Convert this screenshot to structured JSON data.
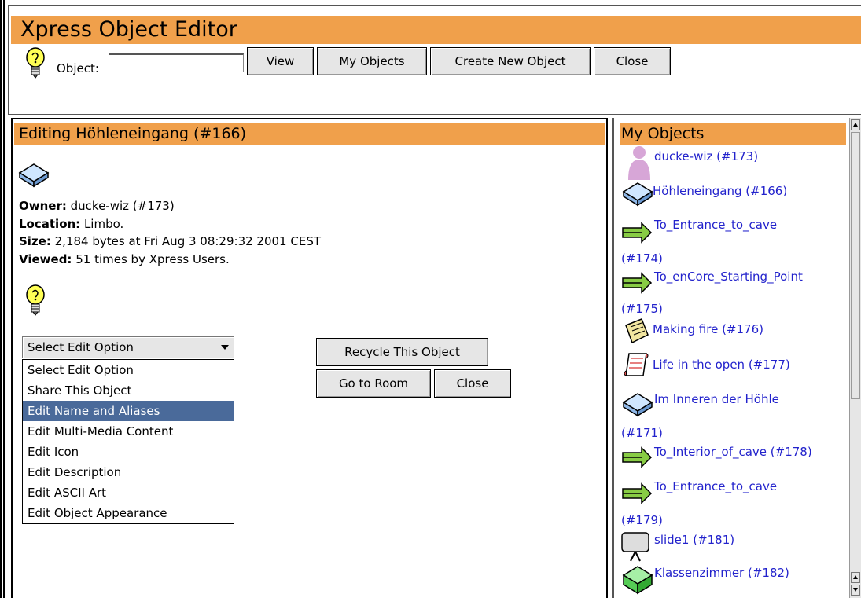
{
  "header": {
    "title": "Xpress Object Editor",
    "object_label": "Object:",
    "object_value": "",
    "buttons": {
      "view": "View",
      "my_objects": "My Objects",
      "create_new": "Create New Object",
      "close": "Close"
    }
  },
  "editor": {
    "heading": "Editing Höhleneingang (#166)",
    "owner_label": "Owner:",
    "owner_value": "ducke-wiz (#173)",
    "location_label": "Location:",
    "location_value": "Limbo.",
    "size_label": "Size:",
    "size_value": "2,184 bytes at Fri Aug 3 08:29:32 2001 CEST",
    "viewed_label": "Viewed:",
    "viewed_value": "51 times by Xpress Users.",
    "select_value": "Select Edit Option",
    "options": [
      "Select Edit Option",
      "Share This Object",
      "Edit Name and Aliases",
      "Edit Multi-Media Content",
      "Edit Icon",
      "Edit Description",
      "Edit ASCII Art",
      "Edit Object Appearance"
    ],
    "buttons": {
      "recycle": "Recycle This Object",
      "goto_room": "Go to Room",
      "close": "Close"
    }
  },
  "my_objects": {
    "heading": "My Objects",
    "items": [
      {
        "label": "ducke-wiz (#173)",
        "icon": "person-icon"
      },
      {
        "label": "Höhleneingang (#166)",
        "icon": "room-icon"
      },
      {
        "label": "To_Entrance_to_cave",
        "label2": "(#174)",
        "icon": "exit-arrow-icon"
      },
      {
        "label": "To_enCore_Starting_Point",
        "label2": "(#175)",
        "icon": "exit-arrow-icon"
      },
      {
        "label": "Making fire (#176)",
        "icon": "note-icon"
      },
      {
        "label": "Life in the open (#177)",
        "icon": "scroll-icon"
      },
      {
        "label": "Im Inneren der Höhle",
        "label2": "(#171)",
        "icon": "room-icon"
      },
      {
        "label": "To_Interior_of_cave (#178)",
        "icon": "exit-arrow-icon"
      },
      {
        "label": "To_Entrance_to_cave",
        "label2": "(#179)",
        "icon": "exit-arrow-icon"
      },
      {
        "label": "slide1 (#181)",
        "icon": "slide-projector-icon"
      },
      {
        "label": "Klassenzimmer (#182)",
        "icon": "green-room-icon"
      }
    ]
  }
}
